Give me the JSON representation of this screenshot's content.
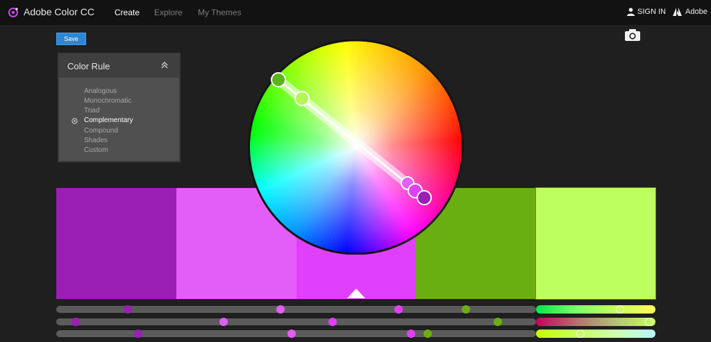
{
  "app": {
    "title": "Adobe Color CC"
  },
  "nav": {
    "items": [
      {
        "label": "Create",
        "active": true
      },
      {
        "label": "Explore",
        "active": false
      },
      {
        "label": "My Themes",
        "active": false
      }
    ]
  },
  "header": {
    "signin_label": "SIGN IN",
    "adobe_label": "Adobe"
  },
  "toolbar": {
    "save_label": "Save"
  },
  "color_rule": {
    "title": "Color Rule",
    "options": [
      "Analogous",
      "Monochromatic",
      "Triad",
      "Complementary",
      "Compound",
      "Shades",
      "Custom"
    ],
    "selected": "Complementary"
  },
  "swatches": [
    "#9b1fb5",
    "#e35ef8",
    "#e040fb",
    "#6aaf12",
    "#bdff5e"
  ],
  "base_swatch_index": 2,
  "sliders": {
    "row1_dot_colors": [
      "#9b1fb5",
      "#e35ef8",
      "#e040fb",
      "#6aaf12"
    ],
    "row2_dot_colors": [
      "#9b1fb5",
      "#e35ef8",
      "#e040fb",
      "#6aaf12"
    ],
    "row3_dot_colors": [
      "#9b1fb5",
      "#e35ef8",
      "#e040fb",
      "#6aaf12"
    ]
  }
}
